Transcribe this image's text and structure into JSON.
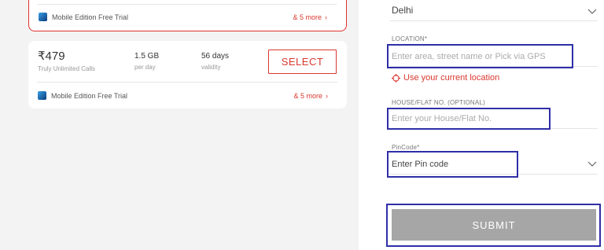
{
  "plans": {
    "top_card": {
      "benefit": "Mobile Edition Free Trial",
      "more": "& 5 more"
    },
    "card": {
      "price": "₹479",
      "calls": "Truly Unlimited Calls",
      "data": "1.5 GB",
      "data_sub": "per day",
      "validity": "56 days",
      "validity_sub": "validity",
      "select_label": "SELECT",
      "benefit": "Mobile Edition Free Trial",
      "more": "& 5 more"
    }
  },
  "form": {
    "city": {
      "value": "Delhi"
    },
    "location": {
      "label": "LOCATION*",
      "placeholder": "Enter area, street name or Pick via GPS",
      "gps_label": "Use your current location"
    },
    "house": {
      "label": "HOUSE/FLAT NO. (OPTIONAL)",
      "placeholder": "Enter your House/Flat No."
    },
    "pincode": {
      "label": "PinCode*",
      "placeholder": "Enter Pin code"
    },
    "submit_label": "SUBMIT"
  },
  "colors": {
    "accent": "#d9372f",
    "highlight": "#2f2fa8",
    "submit_disabled": "#a6a6a6"
  }
}
